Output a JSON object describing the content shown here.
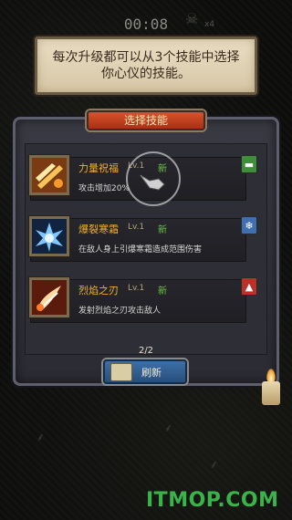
{
  "hud": {
    "timer": "00:08",
    "kill_count": "x4"
  },
  "tip": {
    "text": "每次升级都可以从3个技能中选择你心仪的技能。"
  },
  "panel": {
    "title": "选择技能"
  },
  "skills": [
    {
      "name": "力量祝福",
      "level": "Lv.1",
      "new_label": "新",
      "desc": "攻击增加20%",
      "icon": "strength-blessing-icon",
      "badge_icon": "book-icon",
      "badge_color": "#3f8f3a"
    },
    {
      "name": "爆裂寒霜",
      "level": "Lv.1",
      "new_label": "新",
      "desc": "在敌人身上引爆寒霜造成范围伤害",
      "icon": "frost-burst-icon",
      "badge_icon": "snowflake-icon",
      "badge_color": "#3f6fb0"
    },
    {
      "name": "烈焰之刃",
      "level": "Lv.1",
      "new_label": "新",
      "desc": "发射烈焰之刃攻击敌人",
      "icon": "flame-blade-icon",
      "badge_icon": "fire-icon",
      "badge_color": "#b8322a"
    }
  ],
  "footer": {
    "page": "2/2",
    "refresh_label": "刷新"
  },
  "watermark": "ITMOP.COM"
}
